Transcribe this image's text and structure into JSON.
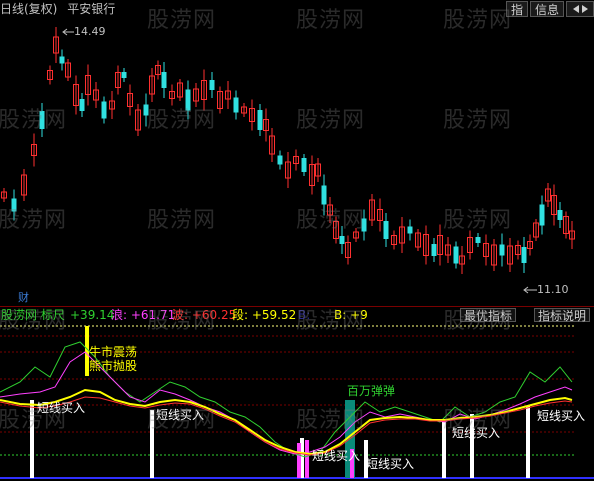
{
  "header": {
    "period": "日线(复权)",
    "stock_name": "平安银行"
  },
  "tabs": {
    "indicator": "指",
    "info": "信息"
  },
  "price_labels": {
    "high": "14.49",
    "low": "11.10"
  },
  "finance_mark": "财",
  "indicators": {
    "name": "股涝网 标尺",
    "biaochi": "+39.14",
    "lang": "浪: +61.71",
    "bo": "波: +60.25",
    "duan": "段: +59.52",
    "hidden": "B:",
    "b": "B: +9",
    "best_btn": "最优指标",
    "help_btn": "指标说明"
  },
  "annotations": {
    "bull_bear": [
      "牛市震荡",
      "熊市抛股"
    ],
    "million": "百万弹弹",
    "buy_short": "短线买入"
  },
  "watermark": "股涝网",
  "colors": {
    "up": "#ff3030",
    "down": "#30e0e0",
    "yellow": "#ffff00",
    "magenta": "#ff40ff",
    "green": "#30d030",
    "white": "#ffffff",
    "teal_bar": "#0a8a7a",
    "dark_red": "#7a0000"
  }
}
